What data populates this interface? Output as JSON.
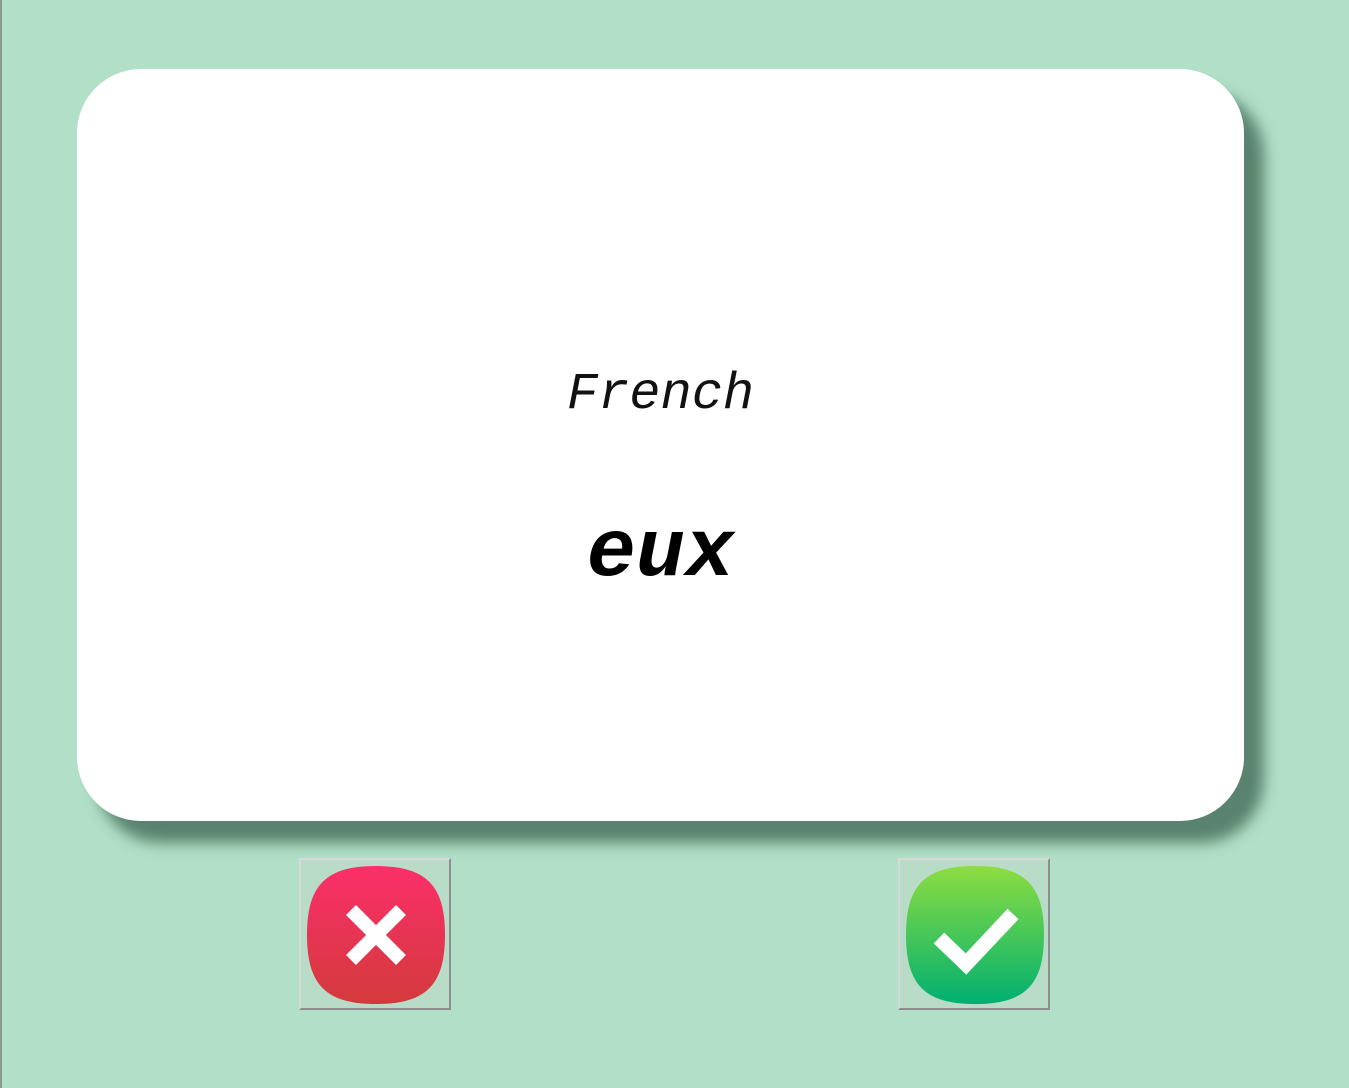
{
  "card": {
    "language": "French",
    "word": "eux"
  },
  "buttons": {
    "wrong_icon": "close-icon",
    "right_icon": "checkmark-icon"
  },
  "colors": {
    "background": "#b1dfc8",
    "card": "#ffffff",
    "wrong": "#e82b5b",
    "right": "#20c56a"
  }
}
